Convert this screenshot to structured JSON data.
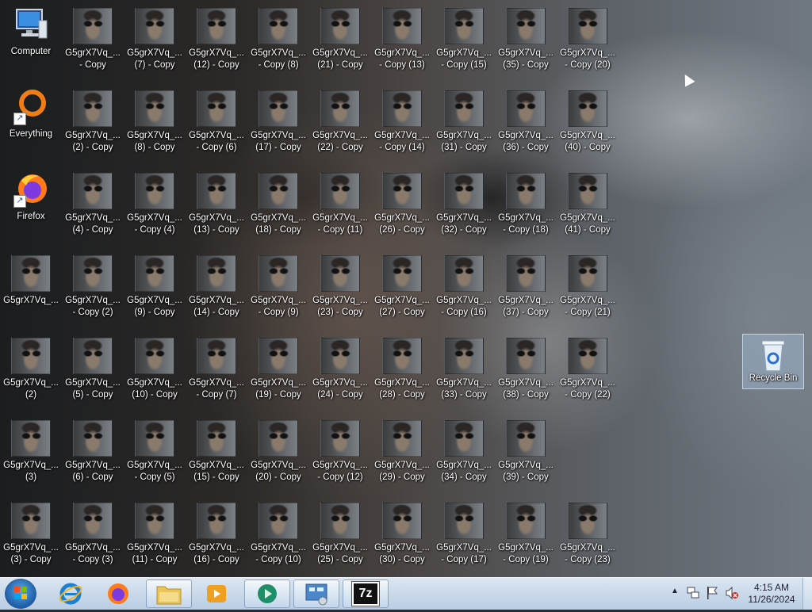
{
  "desktop": {
    "system_icons": [
      {
        "label": "Computer",
        "icon": "computer-icon"
      },
      {
        "label": "Everything",
        "icon": "everything-icon"
      },
      {
        "label": "Firefox",
        "icon": "firefox-icon"
      }
    ],
    "file_icons": [
      [
        null,
        {
          "l1": "G5grX7Vq_...",
          "l2": "- Copy"
        },
        {
          "l1": "G5grX7Vq_...",
          "l2": "(7) - Copy"
        },
        {
          "l1": "G5grX7Vq_...",
          "l2": "(12) - Copy"
        },
        {
          "l1": "G5grX7Vq_...",
          "l2": "- Copy (8)"
        },
        {
          "l1": "G5grX7Vq_...",
          "l2": "(21) - Copy"
        },
        {
          "l1": "G5grX7Vq_...",
          "l2": "- Copy (13)"
        },
        {
          "l1": "G5grX7Vq_...",
          "l2": "- Copy (15)"
        },
        {
          "l1": "G5grX7Vq_...",
          "l2": "(35) - Copy"
        },
        {
          "l1": "G5grX7Vq_...",
          "l2": "- Copy (20)"
        }
      ],
      [
        null,
        {
          "l1": "G5grX7Vq_...",
          "l2": "(2) - Copy"
        },
        {
          "l1": "G5grX7Vq_...",
          "l2": "(8) - Copy"
        },
        {
          "l1": "G5grX7Vq_...",
          "l2": "- Copy (6)"
        },
        {
          "l1": "G5grX7Vq_...",
          "l2": "(17) - Copy"
        },
        {
          "l1": "G5grX7Vq_...",
          "l2": "(22) - Copy"
        },
        {
          "l1": "G5grX7Vq_...",
          "l2": "- Copy (14)"
        },
        {
          "l1": "G5grX7Vq_...",
          "l2": "(31) - Copy"
        },
        {
          "l1": "G5grX7Vq_...",
          "l2": "(36) - Copy"
        },
        {
          "l1": "G5grX7Vq_...",
          "l2": "(40) - Copy"
        }
      ],
      [
        null,
        {
          "l1": "G5grX7Vq_...",
          "l2": "(4) - Copy"
        },
        {
          "l1": "G5grX7Vq_...",
          "l2": "- Copy (4)"
        },
        {
          "l1": "G5grX7Vq_...",
          "l2": "(13) - Copy"
        },
        {
          "l1": "G5grX7Vq_...",
          "l2": "(18) - Copy"
        },
        {
          "l1": "G5grX7Vq_...",
          "l2": "- Copy (11)"
        },
        {
          "l1": "G5grX7Vq_...",
          "l2": "(26) - Copy"
        },
        {
          "l1": "G5grX7Vq_...",
          "l2": "(32) - Copy"
        },
        {
          "l1": "G5grX7Vq_...",
          "l2": "- Copy (18)"
        },
        {
          "l1": "G5grX7Vq_...",
          "l2": "(41) - Copy"
        }
      ],
      [
        {
          "l1": "G5grX7Vq_...",
          "l2": ""
        },
        {
          "l1": "G5grX7Vq_...",
          "l2": "- Copy (2)"
        },
        {
          "l1": "G5grX7Vq_...",
          "l2": "(9) - Copy"
        },
        {
          "l1": "G5grX7Vq_...",
          "l2": "(14) - Copy"
        },
        {
          "l1": "G5grX7Vq_...",
          "l2": "- Copy (9)"
        },
        {
          "l1": "G5grX7Vq_...",
          "l2": "(23) - Copy"
        },
        {
          "l1": "G5grX7Vq_...",
          "l2": "(27) - Copy"
        },
        {
          "l1": "G5grX7Vq_...",
          "l2": "- Copy (16)"
        },
        {
          "l1": "G5grX7Vq_...",
          "l2": "(37) - Copy"
        },
        {
          "l1": "G5grX7Vq_...",
          "l2": "- Copy (21)"
        }
      ],
      [
        {
          "l1": "G5grX7Vq_...",
          "l2": "(2)"
        },
        {
          "l1": "G5grX7Vq_...",
          "l2": "(5) - Copy"
        },
        {
          "l1": "G5grX7Vq_...",
          "l2": "(10) - Copy"
        },
        {
          "l1": "G5grX7Vq_...",
          "l2": "- Copy (7)"
        },
        {
          "l1": "G5grX7Vq_...",
          "l2": "(19) - Copy"
        },
        {
          "l1": "G5grX7Vq_...",
          "l2": "(24) - Copy"
        },
        {
          "l1": "G5grX7Vq_...",
          "l2": "(28) - Copy"
        },
        {
          "l1": "G5grX7Vq_...",
          "l2": "(33) - Copy"
        },
        {
          "l1": "G5grX7Vq_...",
          "l2": "(38) - Copy"
        },
        {
          "l1": "G5grX7Vq_...",
          "l2": "- Copy (22)"
        }
      ],
      [
        {
          "l1": "G5grX7Vq_...",
          "l2": "(3)"
        },
        {
          "l1": "G5grX7Vq_...",
          "l2": "(6) - Copy"
        },
        {
          "l1": "G5grX7Vq_...",
          "l2": "- Copy (5)"
        },
        {
          "l1": "G5grX7Vq_...",
          "l2": "(15) - Copy"
        },
        {
          "l1": "G5grX7Vq_...",
          "l2": "(20) - Copy"
        },
        {
          "l1": "G5grX7Vq_...",
          "l2": "- Copy (12)"
        },
        {
          "l1": "G5grX7Vq_...",
          "l2": "(29) - Copy"
        },
        {
          "l1": "G5grX7Vq_...",
          "l2": "(34) - Copy"
        },
        {
          "l1": "G5grX7Vq_...",
          "l2": "(39) - Copy"
        },
        null
      ],
      [
        {
          "l1": "G5grX7Vq_...",
          "l2": "(3) - Copy"
        },
        {
          "l1": "G5grX7Vq_...",
          "l2": "- Copy (3)"
        },
        {
          "l1": "G5grX7Vq_...",
          "l2": "(11) - Copy"
        },
        {
          "l1": "G5grX7Vq_...",
          "l2": "(16) - Copy"
        },
        {
          "l1": "G5grX7Vq_...",
          "l2": "- Copy (10)"
        },
        {
          "l1": "G5grX7Vq_...",
          "l2": "(25) - Copy"
        },
        {
          "l1": "G5grX7Vq_...",
          "l2": "(30) - Copy"
        },
        {
          "l1": "G5grX7Vq_...",
          "l2": "- Copy (17)"
        },
        {
          "l1": "G5grX7Vq_...",
          "l2": "- Copy (19)"
        },
        {
          "l1": "G5grX7Vq_...",
          "l2": "- Copy (23)"
        }
      ]
    ],
    "recycle_bin": {
      "label": "Recycle Bin",
      "icon": "recycle-bin-icon"
    }
  },
  "taskbar": {
    "start_icon": "windows-start-icon",
    "pinned": [
      {
        "name": "internet-explorer",
        "icon": "internet-explorer-icon",
        "active": false
      },
      {
        "name": "firefox",
        "icon": "firefox-icon",
        "active": false
      },
      {
        "name": "file-explorer",
        "icon": "folder-icon",
        "active": true
      },
      {
        "name": "media-player",
        "icon": "media-player-icon",
        "active": false
      },
      {
        "name": "app-green",
        "icon": "green-app-icon",
        "active": true
      },
      {
        "name": "control-panel",
        "icon": "control-panel-icon",
        "active": true
      },
      {
        "name": "7zip",
        "icon": "7zip-icon",
        "label": "7z",
        "active": true
      }
    ],
    "tray": {
      "time": "4:15 AM",
      "date": "11/26/2024",
      "icons": [
        "chevron-up-icon",
        "network-icon",
        "flag-icon",
        "volume-muted-icon"
      ]
    }
  },
  "colors": {
    "taskbar": "#c8d9ea",
    "selection": "#b4d2f0"
  }
}
